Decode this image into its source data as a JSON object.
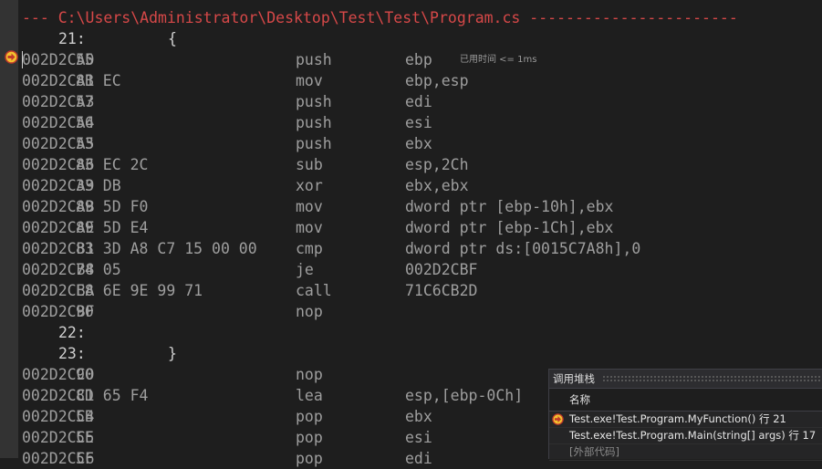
{
  "disassembly": {
    "header": "--- C:\\Users\\Administrator\\Desktop\\Test\\Test\\Program.cs -----------------------",
    "rows": [
      {
        "kind": "src",
        "lineno": "21:",
        "code": "{"
      },
      {
        "kind": "asm",
        "addr": "002D2CA0",
        "bytes": "55",
        "mnemonic": "push",
        "operands": "ebp",
        "timing": "已用时间 <= 1ms"
      },
      {
        "kind": "asm",
        "addr": "002D2CA1",
        "bytes": "8B EC",
        "mnemonic": "mov",
        "operands": "ebp,esp"
      },
      {
        "kind": "asm",
        "addr": "002D2CA3",
        "bytes": "57",
        "mnemonic": "push",
        "operands": "edi"
      },
      {
        "kind": "asm",
        "addr": "002D2CA4",
        "bytes": "56",
        "mnemonic": "push",
        "operands": "esi"
      },
      {
        "kind": "asm",
        "addr": "002D2CA5",
        "bytes": "53",
        "mnemonic": "push",
        "operands": "ebx"
      },
      {
        "kind": "asm",
        "addr": "002D2CA6",
        "bytes": "83 EC 2C",
        "mnemonic": "sub",
        "operands": "esp,2Ch"
      },
      {
        "kind": "asm",
        "addr": "002D2CA9",
        "bytes": "33 DB",
        "mnemonic": "xor",
        "operands": "ebx,ebx"
      },
      {
        "kind": "asm",
        "addr": "002D2CAB",
        "bytes": "89 5D F0",
        "mnemonic": "mov",
        "operands": "dword ptr [ebp-10h],ebx"
      },
      {
        "kind": "asm",
        "addr": "002D2CAE",
        "bytes": "89 5D E4",
        "mnemonic": "mov",
        "operands": "dword ptr [ebp-1Ch],ebx"
      },
      {
        "kind": "asm",
        "addr": "002D2CB1",
        "bytes": "83 3D A8 C7 15 00 00",
        "mnemonic": "cmp",
        "operands": "dword ptr ds:[0015C7A8h],0"
      },
      {
        "kind": "asm",
        "addr": "002D2CB8",
        "bytes": "74 05",
        "mnemonic": "je",
        "operands": "002D2CBF"
      },
      {
        "kind": "asm",
        "addr": "002D2CBA",
        "bytes": "E8 6E 9E 99 71",
        "mnemonic": "call",
        "operands": "71C6CB2D"
      },
      {
        "kind": "asm",
        "addr": "002D2CBF",
        "bytes": "90",
        "mnemonic": "nop",
        "operands": ""
      },
      {
        "kind": "src",
        "lineno": "22:",
        "code": ""
      },
      {
        "kind": "src",
        "lineno": "23:",
        "code": "}"
      },
      {
        "kind": "asm",
        "addr": "002D2CC0",
        "bytes": "90",
        "mnemonic": "nop",
        "operands": ""
      },
      {
        "kind": "asm",
        "addr": "002D2CC1",
        "bytes": "8D 65 F4",
        "mnemonic": "lea",
        "operands": "esp,[ebp-0Ch]"
      },
      {
        "kind": "asm",
        "addr": "002D2CC4",
        "bytes": "5B",
        "mnemonic": "pop",
        "operands": "ebx"
      },
      {
        "kind": "asm",
        "addr": "002D2CC5",
        "bytes": "5E",
        "mnemonic": "pop",
        "operands": "esi"
      },
      {
        "kind": "asm",
        "addr": "002D2CC6",
        "bytes": "5F",
        "mnemonic": "pop",
        "operands": "edi"
      }
    ]
  },
  "current_instruction_icon": "current-statement-arrow-icon",
  "call_stack": {
    "title": "调用堆栈",
    "column_name": "名称",
    "frames": [
      {
        "text": "Test.exe!Test.Program.MyFunction() 行 21",
        "current": true,
        "external": false
      },
      {
        "text": "Test.exe!Test.Program.Main(string[] args) 行 17",
        "current": false,
        "external": false
      },
      {
        "text": "[外部代码]",
        "current": false,
        "external": true
      }
    ]
  },
  "colors": {
    "background": "#1e1e1e",
    "header_red": "#d64848",
    "asm_text": "#9e9e9e",
    "source_text": "#cfcfcf",
    "arrow_yellow": "#f2c12e",
    "arrow_border": "#c0392b"
  }
}
